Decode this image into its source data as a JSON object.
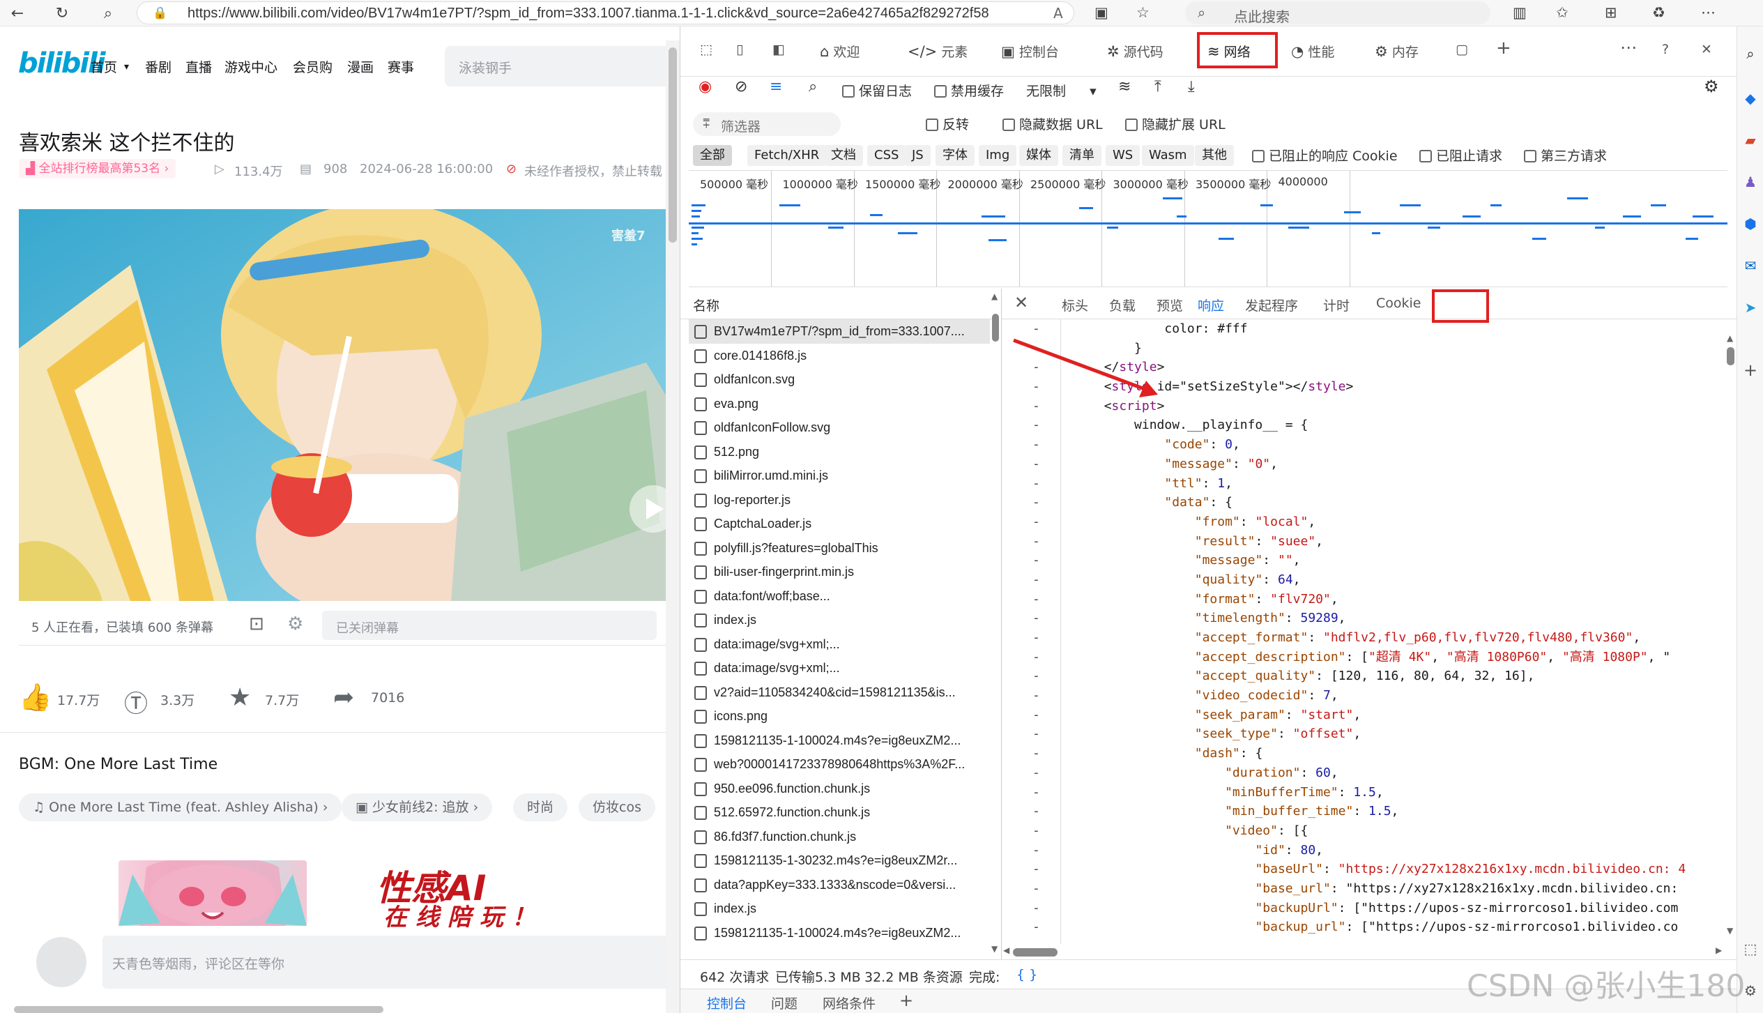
{
  "browser": {
    "url": "https://www.bilibili.com/video/BV17w4m1e7PT/?spm_id_from=333.1007.tianma.1-1-1.click&vd_source=2a6e427465a2f829272f586...",
    "search_placeholder": "点此搜索"
  },
  "bili": {
    "logo": "bilibili",
    "nav": [
      "首页",
      "番剧",
      "直播",
      "游戏中心",
      "会员购",
      "漫画",
      "赛事"
    ],
    "search_placeholder": "泳装钢手",
    "title": "喜欢索米 这个拦不住的",
    "rank_badge": "全站排行榜最高第53名",
    "views": "113.4万",
    "danmaku_count": "908",
    "date": "2024-06-28 16:00:00",
    "notice": "未经作者授权，禁止转载",
    "watermark_corner": "害羞7",
    "watching": "5 人正在看，已装填 600 条弹幕",
    "danmaku_placeholder": "已关闭弹幕",
    "likes": "17.7万",
    "coins": "3.3万",
    "favorites": "7.7万",
    "shares": "7016",
    "bgm": "BGM: One More Last Time",
    "tags": [
      "One More Last Time (feat. Ashley Alisha)",
      "少女前线2: 追放",
      "时尚",
      "仿妆cos"
    ],
    "ad_line1": "性感AI",
    "ad_line2": "在线陪玩！",
    "comment_placeholder": "天青色等烟雨，评论区在等你"
  },
  "devtools": {
    "tabs": [
      "欢迎",
      "元素",
      "控制台",
      "源代码",
      "网络",
      "性能",
      "内存"
    ],
    "toolbar": {
      "preserve_log": "保留日志",
      "disable_cache": "禁用缓存",
      "throttle": "无限制"
    },
    "filter_placeholder": "筛选器",
    "invert": "反转",
    "hide_data_url": "隐藏数据 URL",
    "hide_ext_url": "隐藏扩展 URL",
    "types": [
      "全部",
      "Fetch/XHR",
      "文档",
      "CSS",
      "JS",
      "字体",
      "Img",
      "媒体",
      "清单",
      "WS",
      "Wasm",
      "其他"
    ],
    "blocked_cookies": "已阻止的响应 Cookie",
    "blocked_requests": "已阻止请求",
    "third_party": "第三方请求",
    "timeline_ticks": [
      "500000 毫秒",
      "1000000 毫秒",
      "1500000 毫秒",
      "2000000 毫秒",
      "2500000 毫秒",
      "3000000 毫秒",
      "3500000 毫秒",
      "4000000"
    ],
    "name_header": "名称",
    "requests": [
      "BV17w4m1e7PT/?spm_id_from=333.1007....",
      "core.014186f8.js",
      "oldfanIcon.svg",
      "eva.png",
      "oldfanIconFollow.svg",
      "512.png",
      "biliMirror.umd.mini.js",
      "log-reporter.js",
      "CaptchaLoader.js",
      "polyfill.js?features=globalThis",
      "bili-user-fingerprint.min.js",
      "data:font/woff;base...",
      "index.js",
      "data:image/svg+xml;...",
      "data:image/svg+xml;...",
      "v2?aid=1105834240&cid=1598121135&is...",
      "icons.png",
      "1598121135-1-100024.m4s?e=ig8euxZM2...",
      "web?0000141723378980648https%3A%2F...",
      "950.ee096.function.chunk.js",
      "512.65972.function.chunk.js",
      "86.fd3f7.function.chunk.js",
      "1598121135-1-30232.m4s?e=ig8euxZM2r...",
      "data?appKey=333.1333&nscode=0&versi...",
      "index.js",
      "1598121135-1-100024.m4s?e=ig8euxZM2..."
    ],
    "detail_tabs": [
      "标头",
      "负载",
      "预览",
      "响应",
      "发起程序",
      "计时",
      "Cookie"
    ],
    "code_lines": [
      "                color: #fff",
      "            }",
      "        </style>",
      "        <style id=\"setSizeStyle\"></style>",
      "        <script>",
      "            window.__playinfo__ = {",
      "                \"code\": 0,",
      "                \"message\": \"0\",",
      "                \"ttl\": 1,",
      "                \"data\": {",
      "                    \"from\": \"local\",",
      "                    \"result\": \"suee\",",
      "                    \"message\": \"\",",
      "                    \"quality\": 64,",
      "                    \"format\": \"flv720\",",
      "                    \"timelength\": 59289,",
      "                    \"accept_format\": \"hdflv2,flv_p60,flv,flv720,flv480,flv360\",",
      "                    \"accept_description\": [\"超清 4K\", \"高清 1080P60\", \"高清 1080P\", \"",
      "                    \"accept_quality\": [120, 116, 80, 64, 32, 16],",
      "                    \"video_codecid\": 7,",
      "                    \"seek_param\": \"start\",",
      "                    \"seek_type\": \"offset\",",
      "                    \"dash\": {",
      "                        \"duration\": 60,",
      "                        \"minBufferTime\": 1.5,",
      "                        \"min_buffer_time\": 1.5,",
      "                        \"video\": [{",
      "                            \"id\": 80,",
      "                            \"baseUrl\": \"https://xy27x128x216x1xy.mcdn.bilivideo.cn:4",
      "                            \"base_url\": \"https://xy27x128x216x1xy.mcdn.bilivideo.cn:",
      "                            \"backupUrl\": [\"https://upos-sz-mirrorcoso1.bilivideo.com",
      "                            \"backup_url\": [\"https://upos-sz-mirrorcoso1.bilivideo.co"
    ],
    "status": {
      "requests": "642 次请求",
      "transferred": "已传输5.3 MB",
      "resources": "32.2 MB 条资源",
      "finish": "完成:",
      "braces": "{ }"
    },
    "drawer": [
      "控制台",
      "问题",
      "网络条件"
    ]
  },
  "watermark": "CSDN @张小生180",
  "colors": {
    "annotation_red": "#e02020",
    "bili_blue": "#00a1d6",
    "bili_pink": "#ff6699"
  }
}
